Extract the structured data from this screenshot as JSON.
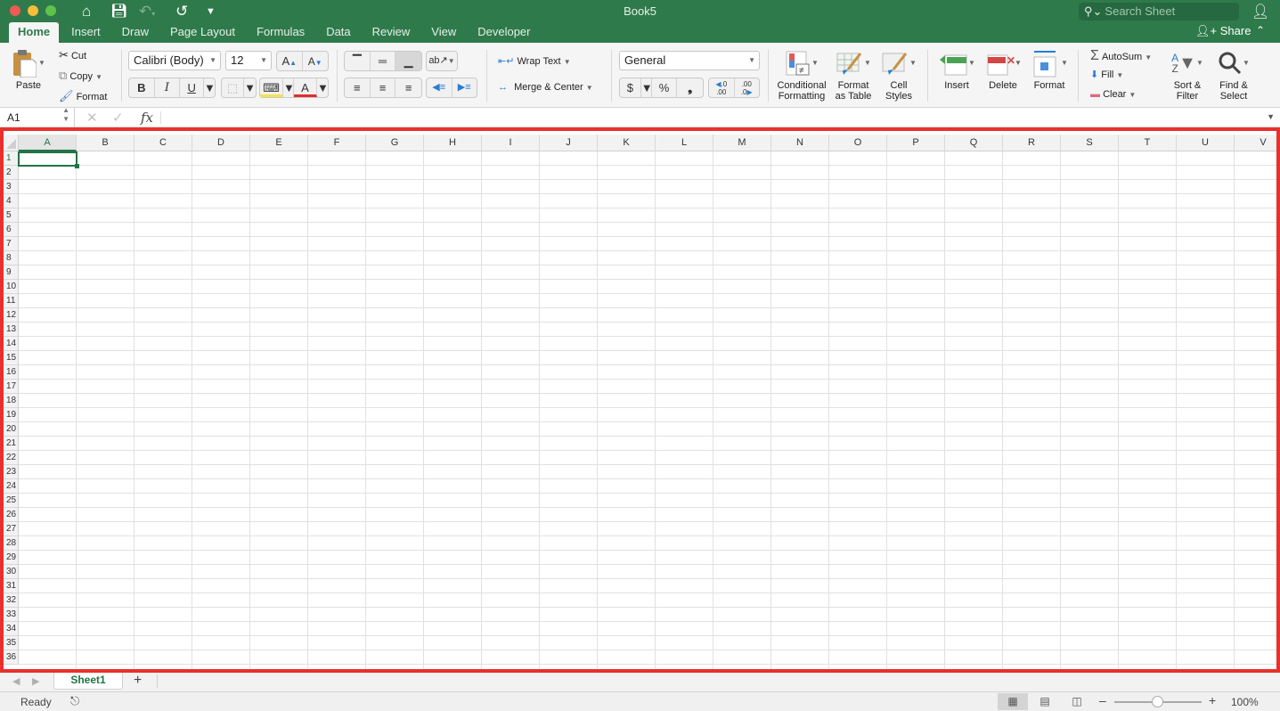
{
  "window": {
    "title": "Book5"
  },
  "quick_access": {
    "icons": [
      "home-icon",
      "save-icon",
      "undo-icon",
      "redo-icon",
      "customize-icon"
    ]
  },
  "search": {
    "placeholder": "Search Sheet"
  },
  "tabs": [
    {
      "label": "Home",
      "active": true
    },
    {
      "label": "Insert"
    },
    {
      "label": "Draw"
    },
    {
      "label": "Page Layout"
    },
    {
      "label": "Formulas"
    },
    {
      "label": "Data"
    },
    {
      "label": "Review"
    },
    {
      "label": "View"
    },
    {
      "label": "Developer"
    }
  ],
  "share_label": "Share",
  "ribbon": {
    "clipboard": {
      "paste": "Paste",
      "cut": "Cut",
      "copy": "Copy",
      "format": "Format"
    },
    "font": {
      "name": "Calibri (Body)",
      "size": "12",
      "bold": "B",
      "italic": "I",
      "underline": "U",
      "grow": "A",
      "shrink": "A",
      "font_color": "A"
    },
    "alignment": {
      "wrap_text": "Wrap Text",
      "merge_center": "Merge & Center"
    },
    "number": {
      "format": "General",
      "currency": "$",
      "percent": "%",
      "comma": "❟",
      "inc_dec": ".0\n.00",
      "dec_dec": ".00\n.0"
    },
    "styles": {
      "conditional": "Conditional\nFormatting",
      "format_table": "Format\nas Table",
      "cell_styles": "Cell\nStyles"
    },
    "cells": {
      "insert": "Insert",
      "delete": "Delete",
      "format": "Format"
    },
    "editing": {
      "autosum": "AutoSum",
      "fill": "Fill",
      "clear": "Clear",
      "sort_filter": "Sort &\nFilter",
      "find_select": "Find &\nSelect"
    }
  },
  "formula_bar": {
    "name_box": "A1",
    "formula": "",
    "fx": "fx"
  },
  "grid": {
    "columns": [
      "A",
      "B",
      "C",
      "D",
      "E",
      "F",
      "G",
      "H",
      "I",
      "J",
      "K",
      "L",
      "M",
      "N",
      "O",
      "P",
      "Q",
      "R",
      "S",
      "T",
      "U",
      "V"
    ],
    "rows": 36,
    "selected_cell": "A1"
  },
  "sheets": [
    {
      "name": "Sheet1",
      "active": true
    }
  ],
  "status": {
    "text": "Ready",
    "zoom": "100%",
    "zoom_level": 1.0
  },
  "colors": {
    "brand": "#2f7a4b",
    "accent": "#217346",
    "highlight": "#e9302c"
  }
}
